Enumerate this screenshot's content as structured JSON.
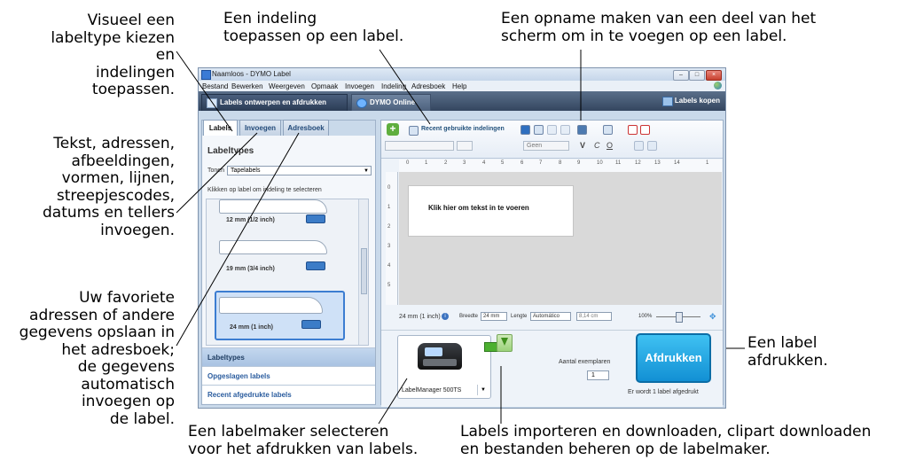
{
  "callouts": {
    "label_type": "Visueel een\nlabeltype kiezen en\nindelingen\ntoepassen.",
    "insert": "Tekst, adressen,\nafbeeldingen,\nvormen, lijnen,\nstreepjescodes,\ndatums en tellers\ninvoegen.",
    "addressbook": "Uw favoriete\nadressen of andere\ngegevens opslaan in\nhet adresboek;\nde gegevens\nautomatisch\ninvoegen op\nde label.",
    "layout": "Een indeling\ntoepassen op een label.",
    "screenshot": "Een opname maken van een deel van het\nscherm om in te voegen op een label.",
    "print": "Een label\nafdrukken.",
    "select_printer": "Een labelmaker selecteren\nvoor het afdrukken van labels.",
    "import": "Labels importeren en downloaden, clipart downloaden\nen bestanden beheren op de labelmaker."
  },
  "window": {
    "title": "Naamloos - DYMO Label",
    "menu": [
      "Bestand",
      "Bewerken",
      "Weergeven",
      "Opmaak",
      "Invoegen",
      "Indeling",
      "Adresboek",
      "Help"
    ],
    "tab_design": "Labels ontwerpen en afdrukken",
    "tab_online": "DYMO Online",
    "buy_labels": "Labels kopen"
  },
  "left": {
    "tabs": [
      "Labels",
      "Invoegen",
      "Adresboek"
    ],
    "title": "Labeltypes",
    "show_label": "Tonen",
    "show_value": "Tapelabels",
    "hint": "Klikken op label om indeling te selecteren",
    "labels": [
      "12 mm (1/2 inch)",
      "19 mm (3/4 inch)",
      "24 mm (1 inch)"
    ],
    "sections": [
      "Labeltypes",
      "Opgeslagen labels",
      "Recent afgedrukte labels"
    ]
  },
  "right": {
    "recent_layouts": "Recent gebruikte indelingen",
    "font_value": "Geen",
    "ruler_marks": [
      "0",
      "1",
      "2",
      "3",
      "4",
      "5",
      "6",
      "7",
      "8",
      "9",
      "10",
      "11",
      "12",
      "13",
      "14",
      "1"
    ],
    "ruler_v_marks": [
      "0",
      "1",
      "2",
      "3",
      "4",
      "5"
    ],
    "placeholder": "Klik hier om tekst in te voeren",
    "size_info": "24 mm (1 inch)",
    "width_label": "Breedte",
    "width_value": "24 mm",
    "length_label": "Lengte",
    "length_value": "Automático",
    "length_cm": "8,14 cm",
    "zoom": "100%",
    "printer_name": "LabelManager 500TS",
    "copies_label": "Aantal exemplaren",
    "copies_value": "1",
    "print_button": "Afdrukken",
    "print_status": "Er wordt 1 label afgedrukt"
  },
  "colors": {
    "accent": "#1290d4",
    "navbar": "#34465f"
  }
}
